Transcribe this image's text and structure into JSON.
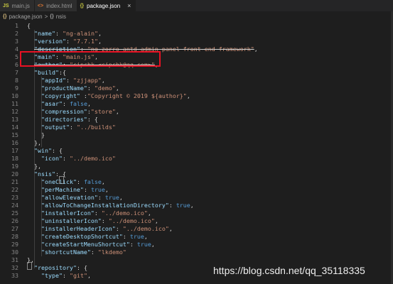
{
  "tabs": [
    {
      "icon": "JS",
      "label": "main.js",
      "active": false,
      "icon_color": "#cbcb41"
    },
    {
      "icon": "<>",
      "label": "index.html",
      "active": false,
      "icon_color": "#e37933"
    },
    {
      "icon": "{}",
      "label": "package.json",
      "active": true,
      "icon_color": "#cbcb41",
      "close": "×"
    }
  ],
  "breadcrumb": {
    "file_icon": "{}",
    "file": "package.json",
    "separator": ">",
    "node_icon": "{}",
    "node": "nsis"
  },
  "lines": [
    {
      "n": "1",
      "t": [
        {
          "c": "p",
          "v": "{"
        }
      ]
    },
    {
      "n": "2",
      "t": [
        {
          "c": "p",
          "v": "  "
        },
        {
          "c": "k",
          "v": "\"name\""
        },
        {
          "c": "p",
          "v": ": "
        },
        {
          "c": "s",
          "v": "\"ng-alain\""
        },
        {
          "c": "p",
          "v": ","
        }
      ]
    },
    {
      "n": "3",
      "t": [
        {
          "c": "p",
          "v": "  "
        },
        {
          "c": "k",
          "v": "\"version\""
        },
        {
          "c": "p",
          "v": ": "
        },
        {
          "c": "s",
          "v": "\"7.7.1\""
        },
        {
          "c": "p",
          "v": ","
        }
      ]
    },
    {
      "n": "4",
      "t": [
        {
          "c": "p",
          "v": "  "
        },
        {
          "c": "k strike",
          "v": "\"description\""
        },
        {
          "c": "p strike",
          "v": ": "
        },
        {
          "c": "s strike",
          "v": "\"ng-zorro-antd-admin panel front-end framework\""
        },
        {
          "c": "p",
          "v": ","
        }
      ]
    },
    {
      "n": "5",
      "t": [
        {
          "c": "p",
          "v": "  "
        },
        {
          "c": "k",
          "v": "\"main\""
        },
        {
          "c": "p",
          "v": ": "
        },
        {
          "c": "s",
          "v": "\"main.js\""
        },
        {
          "c": "p",
          "v": ","
        }
      ]
    },
    {
      "n": "6",
      "t": [
        {
          "c": "p",
          "v": "  "
        },
        {
          "c": "k strike",
          "v": "\"author\""
        },
        {
          "c": "p strike",
          "v": ": "
        },
        {
          "c": "s strike",
          "v": "\"cipchk <cipchk@qq.com>\""
        },
        {
          "c": "p",
          "v": ","
        }
      ]
    },
    {
      "n": "7",
      "t": [
        {
          "c": "p",
          "v": "  "
        },
        {
          "c": "k",
          "v": "\"build\""
        },
        {
          "c": "p",
          "v": ":{"
        }
      ]
    },
    {
      "n": "8",
      "t": [
        {
          "c": "p",
          "v": "    "
        },
        {
          "c": "k",
          "v": "\"appId\""
        },
        {
          "c": "p",
          "v": ": "
        },
        {
          "c": "s",
          "v": "\"zjjapp\""
        },
        {
          "c": "p",
          "v": ","
        }
      ]
    },
    {
      "n": "9",
      "t": [
        {
          "c": "p",
          "v": "    "
        },
        {
          "c": "k",
          "v": "\"productName\""
        },
        {
          "c": "p",
          "v": ": "
        },
        {
          "c": "s",
          "v": "\"demo\""
        },
        {
          "c": "p",
          "v": ","
        }
      ]
    },
    {
      "n": "10",
      "t": [
        {
          "c": "p",
          "v": "    "
        },
        {
          "c": "k",
          "v": "\"copyright\""
        },
        {
          "c": "p",
          "v": " :"
        },
        {
          "c": "s",
          "v": "\"Copyright © 2019 ${author}\""
        },
        {
          "c": "p",
          "v": ","
        }
      ]
    },
    {
      "n": "11",
      "t": [
        {
          "c": "p",
          "v": "    "
        },
        {
          "c": "k",
          "v": "\"asar\""
        },
        {
          "c": "p",
          "v": ": "
        },
        {
          "c": "b",
          "v": "false"
        },
        {
          "c": "p",
          "v": ","
        }
      ]
    },
    {
      "n": "12",
      "t": [
        {
          "c": "p",
          "v": "    "
        },
        {
          "c": "k",
          "v": "\"compression\""
        },
        {
          "c": "p",
          "v": ":"
        },
        {
          "c": "s",
          "v": "\"store\""
        },
        {
          "c": "p",
          "v": ","
        }
      ]
    },
    {
      "n": "13",
      "t": [
        {
          "c": "p",
          "v": "    "
        },
        {
          "c": "k",
          "v": "\"directories\""
        },
        {
          "c": "p",
          "v": ": {"
        }
      ]
    },
    {
      "n": "14",
      "t": [
        {
          "c": "p",
          "v": "    "
        },
        {
          "c": "k",
          "v": "\"output\""
        },
        {
          "c": "p",
          "v": ": "
        },
        {
          "c": "s",
          "v": "\"../builds\""
        }
      ]
    },
    {
      "n": "15",
      "t": [
        {
          "c": "p",
          "v": "    }"
        }
      ]
    },
    {
      "n": "16",
      "t": [
        {
          "c": "p",
          "v": "  },"
        }
      ]
    },
    {
      "n": "17",
      "t": [
        {
          "c": "p",
          "v": "  "
        },
        {
          "c": "k",
          "v": "\"win\""
        },
        {
          "c": "p",
          "v": ": {"
        }
      ]
    },
    {
      "n": "18",
      "t": [
        {
          "c": "p",
          "v": "    "
        },
        {
          "c": "k",
          "v": "\"icon\""
        },
        {
          "c": "p",
          "v": ": "
        },
        {
          "c": "s",
          "v": "\"../demo.ico\""
        }
      ]
    },
    {
      "n": "19",
      "t": [
        {
          "c": "p",
          "v": "  },"
        }
      ]
    },
    {
      "n": "20",
      "t": [
        {
          "c": "p",
          "v": "  "
        },
        {
          "c": "k",
          "v": "\"nsis\""
        },
        {
          "c": "p",
          "v": ": {"
        }
      ]
    },
    {
      "n": "21",
      "t": [
        {
          "c": "p",
          "v": "    "
        },
        {
          "c": "k",
          "v": "\"oneClick\""
        },
        {
          "c": "p",
          "v": ": "
        },
        {
          "c": "b",
          "v": "false"
        },
        {
          "c": "p",
          "v": ","
        }
      ]
    },
    {
      "n": "22",
      "t": [
        {
          "c": "p",
          "v": "    "
        },
        {
          "c": "k",
          "v": "\"perMachine\""
        },
        {
          "c": "p",
          "v": ": "
        },
        {
          "c": "b",
          "v": "true"
        },
        {
          "c": "p",
          "v": ","
        }
      ]
    },
    {
      "n": "23",
      "t": [
        {
          "c": "p",
          "v": "    "
        },
        {
          "c": "k",
          "v": "\"allowElevation\""
        },
        {
          "c": "p",
          "v": ": "
        },
        {
          "c": "b",
          "v": "true"
        },
        {
          "c": "p",
          "v": ","
        }
      ]
    },
    {
      "n": "24",
      "t": [
        {
          "c": "p",
          "v": "    "
        },
        {
          "c": "k",
          "v": "\"allowToChangeInstallationDirectory\""
        },
        {
          "c": "p",
          "v": ": "
        },
        {
          "c": "b",
          "v": "true"
        },
        {
          "c": "p",
          "v": ","
        }
      ]
    },
    {
      "n": "25",
      "t": [
        {
          "c": "p",
          "v": "    "
        },
        {
          "c": "k",
          "v": "\"installerIcon\""
        },
        {
          "c": "p",
          "v": ": "
        },
        {
          "c": "s",
          "v": "\"../demo.ico\""
        },
        {
          "c": "p",
          "v": ","
        }
      ]
    },
    {
      "n": "26",
      "t": [
        {
          "c": "p",
          "v": "    "
        },
        {
          "c": "k",
          "v": "\"uninstallerIcon\""
        },
        {
          "c": "p",
          "v": ": "
        },
        {
          "c": "s",
          "v": "\"../demo.ico\""
        },
        {
          "c": "p",
          "v": ","
        }
      ]
    },
    {
      "n": "27",
      "t": [
        {
          "c": "p",
          "v": "    "
        },
        {
          "c": "k",
          "v": "\"installerHeaderIcon\""
        },
        {
          "c": "p",
          "v": ": "
        },
        {
          "c": "s",
          "v": "\"../demo.ico\""
        },
        {
          "c": "p",
          "v": ","
        }
      ]
    },
    {
      "n": "28",
      "t": [
        {
          "c": "p",
          "v": "    "
        },
        {
          "c": "k",
          "v": "\"createDesktopShortcut\""
        },
        {
          "c": "p",
          "v": ": "
        },
        {
          "c": "b",
          "v": "true"
        },
        {
          "c": "p",
          "v": ","
        }
      ]
    },
    {
      "n": "29",
      "t": [
        {
          "c": "p",
          "v": "    "
        },
        {
          "c": "k",
          "v": "\"createStartMenuShortcut\""
        },
        {
          "c": "p",
          "v": ": "
        },
        {
          "c": "b",
          "v": "true"
        },
        {
          "c": "p",
          "v": ","
        }
      ]
    },
    {
      "n": "30",
      "t": [
        {
          "c": "p",
          "v": "    "
        },
        {
          "c": "k",
          "v": "\"shortcutName\""
        },
        {
          "c": "p",
          "v": ": "
        },
        {
          "c": "s",
          "v": "\"lkdemo\""
        }
      ]
    },
    {
      "n": "31",
      "t": [
        {
          "c": "p",
          "v": "},"
        }
      ]
    },
    {
      "n": "32",
      "t": [
        {
          "c": "p",
          "v": "  "
        },
        {
          "c": "k",
          "v": "\"repository\""
        },
        {
          "c": "p",
          "v": ": {"
        }
      ]
    },
    {
      "n": "33",
      "t": [
        {
          "c": "p",
          "v": "    "
        },
        {
          "c": "k",
          "v": "\"type\""
        },
        {
          "c": "p",
          "v": ": "
        },
        {
          "c": "s",
          "v": "\"git\""
        },
        {
          "c": "p",
          "v": ","
        }
      ]
    }
  ],
  "watermark": "https://blog.csdn.net/qq_35118335"
}
